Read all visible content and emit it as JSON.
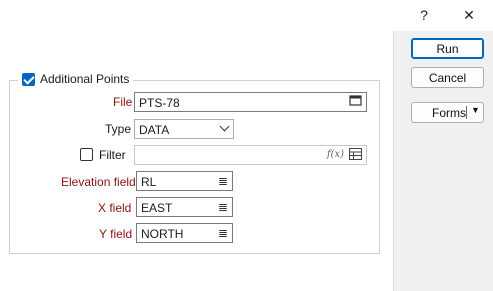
{
  "titlebar": {
    "help_icon": "?",
    "close_icon": "✕"
  },
  "buttons": {
    "run": "Run",
    "cancel": "Cancel",
    "forms": "Forms",
    "forms_arrow": "▼"
  },
  "group": {
    "title": "Additional Points",
    "checked": true
  },
  "form": {
    "file": {
      "label": "File",
      "value": "PTS-78"
    },
    "type": {
      "label": "Type",
      "value": "DATA"
    },
    "filter": {
      "label": "Filter",
      "value": "",
      "checked": false,
      "fx_symbol": "f(x)"
    },
    "elevation": {
      "label": "Elevation field",
      "value": "RL"
    },
    "x": {
      "label": "X field",
      "value": "EAST"
    },
    "y": {
      "label": "Y field",
      "value": "NORTH"
    }
  },
  "icons": {
    "list_glyph": "≣",
    "calendar_glyph": "▭"
  },
  "colors": {
    "accent": "#0067c0",
    "required_label": "#8b1010"
  }
}
